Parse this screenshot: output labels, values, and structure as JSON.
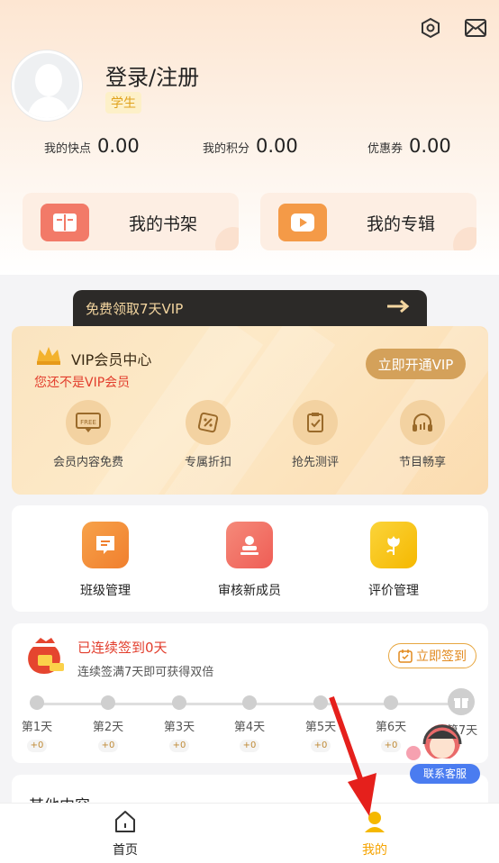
{
  "profile": {
    "username": "登录/注册",
    "badge": "学生"
  },
  "stats": [
    {
      "label": "我的快点",
      "value": "0.00"
    },
    {
      "label": "我的积分",
      "value": "0.00"
    },
    {
      "label": "优惠券",
      "value": "0.00"
    }
  ],
  "quick": {
    "bookshelf": "我的书架",
    "albums": "我的专辑"
  },
  "vip": {
    "banner": "免费领取7天VIP",
    "title": "VIP会员中心",
    "subtitle": "您还不是VIP会员",
    "open_button": "立即开通VIP",
    "benefits": [
      "会员内容免费",
      "专属折扣",
      "抢先测评",
      "节目畅享"
    ],
    "free_tag": "FREE"
  },
  "tools": [
    "班级管理",
    "审核新成员",
    "评价管理"
  ],
  "signin": {
    "title": "已连续签到0天",
    "subtitle": "连续签满7天即可获得双倍",
    "button": "立即签到",
    "days": [
      "第1天",
      "第2天",
      "第3天",
      "第4天",
      "第5天",
      "第6天",
      "第7天"
    ],
    "points": [
      "+0",
      "+0",
      "+0",
      "+0",
      "+0",
      "+0"
    ]
  },
  "other": {
    "title": "其他内容"
  },
  "customer_service": "联系客服",
  "tabbar": {
    "home": "首页",
    "mine": "我的"
  },
  "colors": {
    "accent": "#f5b800",
    "vip_gold": "#d4a15a",
    "alert_red": "#e23d2c"
  }
}
